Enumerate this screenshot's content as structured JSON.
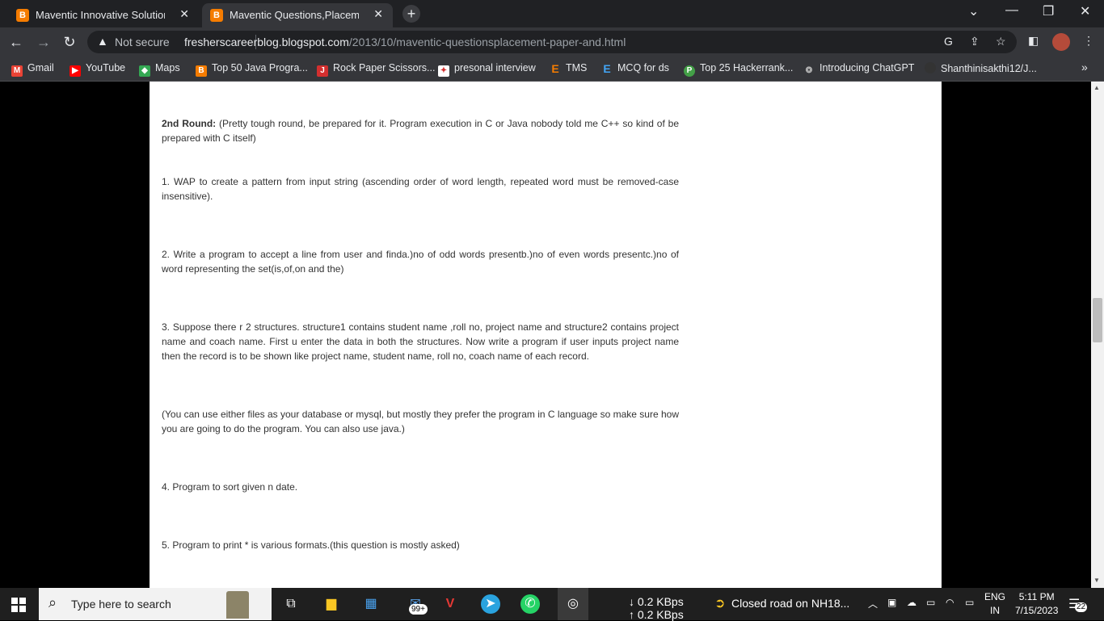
{
  "browser": {
    "tabs": [
      {
        "title": "Maventic Innovative Solutions Pv",
        "favicon": "blogger-orange",
        "close": "✕"
      },
      {
        "title": "Maventic Questions,Placement Pa",
        "favicon": "blogger-orange",
        "close": "✕"
      }
    ],
    "new_tab": "+",
    "window_controls": [
      "⌄",
      "—",
      "❐",
      "✕"
    ],
    "security_label": "Not secure",
    "url_host": "fresherscareerblog.blogspot.com",
    "url_path": "/2013/10/maventic-questionsplacement-paper-and.html"
  },
  "bookmarks": [
    {
      "label": "Gmail",
      "icon": "gmail-icon",
      "color": "#ea4335"
    },
    {
      "label": "YouTube",
      "icon": "youtube-icon",
      "color": "#ff0000"
    },
    {
      "label": "Maps",
      "icon": "maps-icon",
      "color": "#34a853"
    },
    {
      "label": "Top 50 Java Progra...",
      "icon": "blogger-icon",
      "color": "#f57c00"
    },
    {
      "label": "Rock Paper Scissors...",
      "icon": "j-icon",
      "color": "#d32f2f"
    },
    {
      "label": "presonal interview",
      "icon": "grid-icon",
      "color": "#ffffff"
    },
    {
      "label": "TMS",
      "icon": "e-orange-icon",
      "color": "#f57c00"
    },
    {
      "label": "MCQ for ds",
      "icon": "e-blue-icon",
      "color": "#1e88e5"
    },
    {
      "label": "Top 25 Hackerrank...",
      "icon": "p-green-icon",
      "color": "#43a047"
    },
    {
      "label": "Introducing ChatGPT",
      "icon": "openai-icon",
      "color": "#9e9e9e"
    },
    {
      "label": "Shanthinisakthi12/J...",
      "icon": "github-icon",
      "color": "#333333"
    }
  ],
  "bookmarks_more": "»",
  "article": {
    "round_heading": "2nd Round:",
    "round_text": " (Pretty tough round, be prepared for it. Program execution in C or Java nobody told me C++ so kind of be prepared with C itself)",
    "q1": "1.  WAP to create a pattern from input string (ascending order of word length, repeated word must be removed-case insensitive).",
    "q2": "2.  Write a program to accept a line from user and finda.)no of odd words presentb.)no of even words presentc.)no of word representing the set(is,of,on and the)",
    "q3": "3. Suppose there r 2 structures. structure1 contains student name ,roll no, project name and structure2 contains project name and coach name. First u enter the data in both the structures. Now write a program if user inputs project name then the record is to be shown like project name, student name, roll no, coach name of each record.",
    "note": "(You can use either files as your database or mysql, but mostly they prefer the program in C language so make sure how you are going to do the program. You can also use java.)",
    "q4": "4.  Program to sort given n date.",
    "q5": "5.  Program to print * is various formats.(this question is mostly asked)"
  },
  "taskbar": {
    "search_placeholder": "Type here to search",
    "mail_badge": "99+",
    "net_down": "↓ 0.2 KBps",
    "net_up": "↑ 0.2 KBps",
    "news": "Closed road on NH18...",
    "lang_top": "ENG",
    "lang_bottom": "IN",
    "time": "5:11 PM",
    "date": "7/15/2023",
    "notifications": "22"
  }
}
